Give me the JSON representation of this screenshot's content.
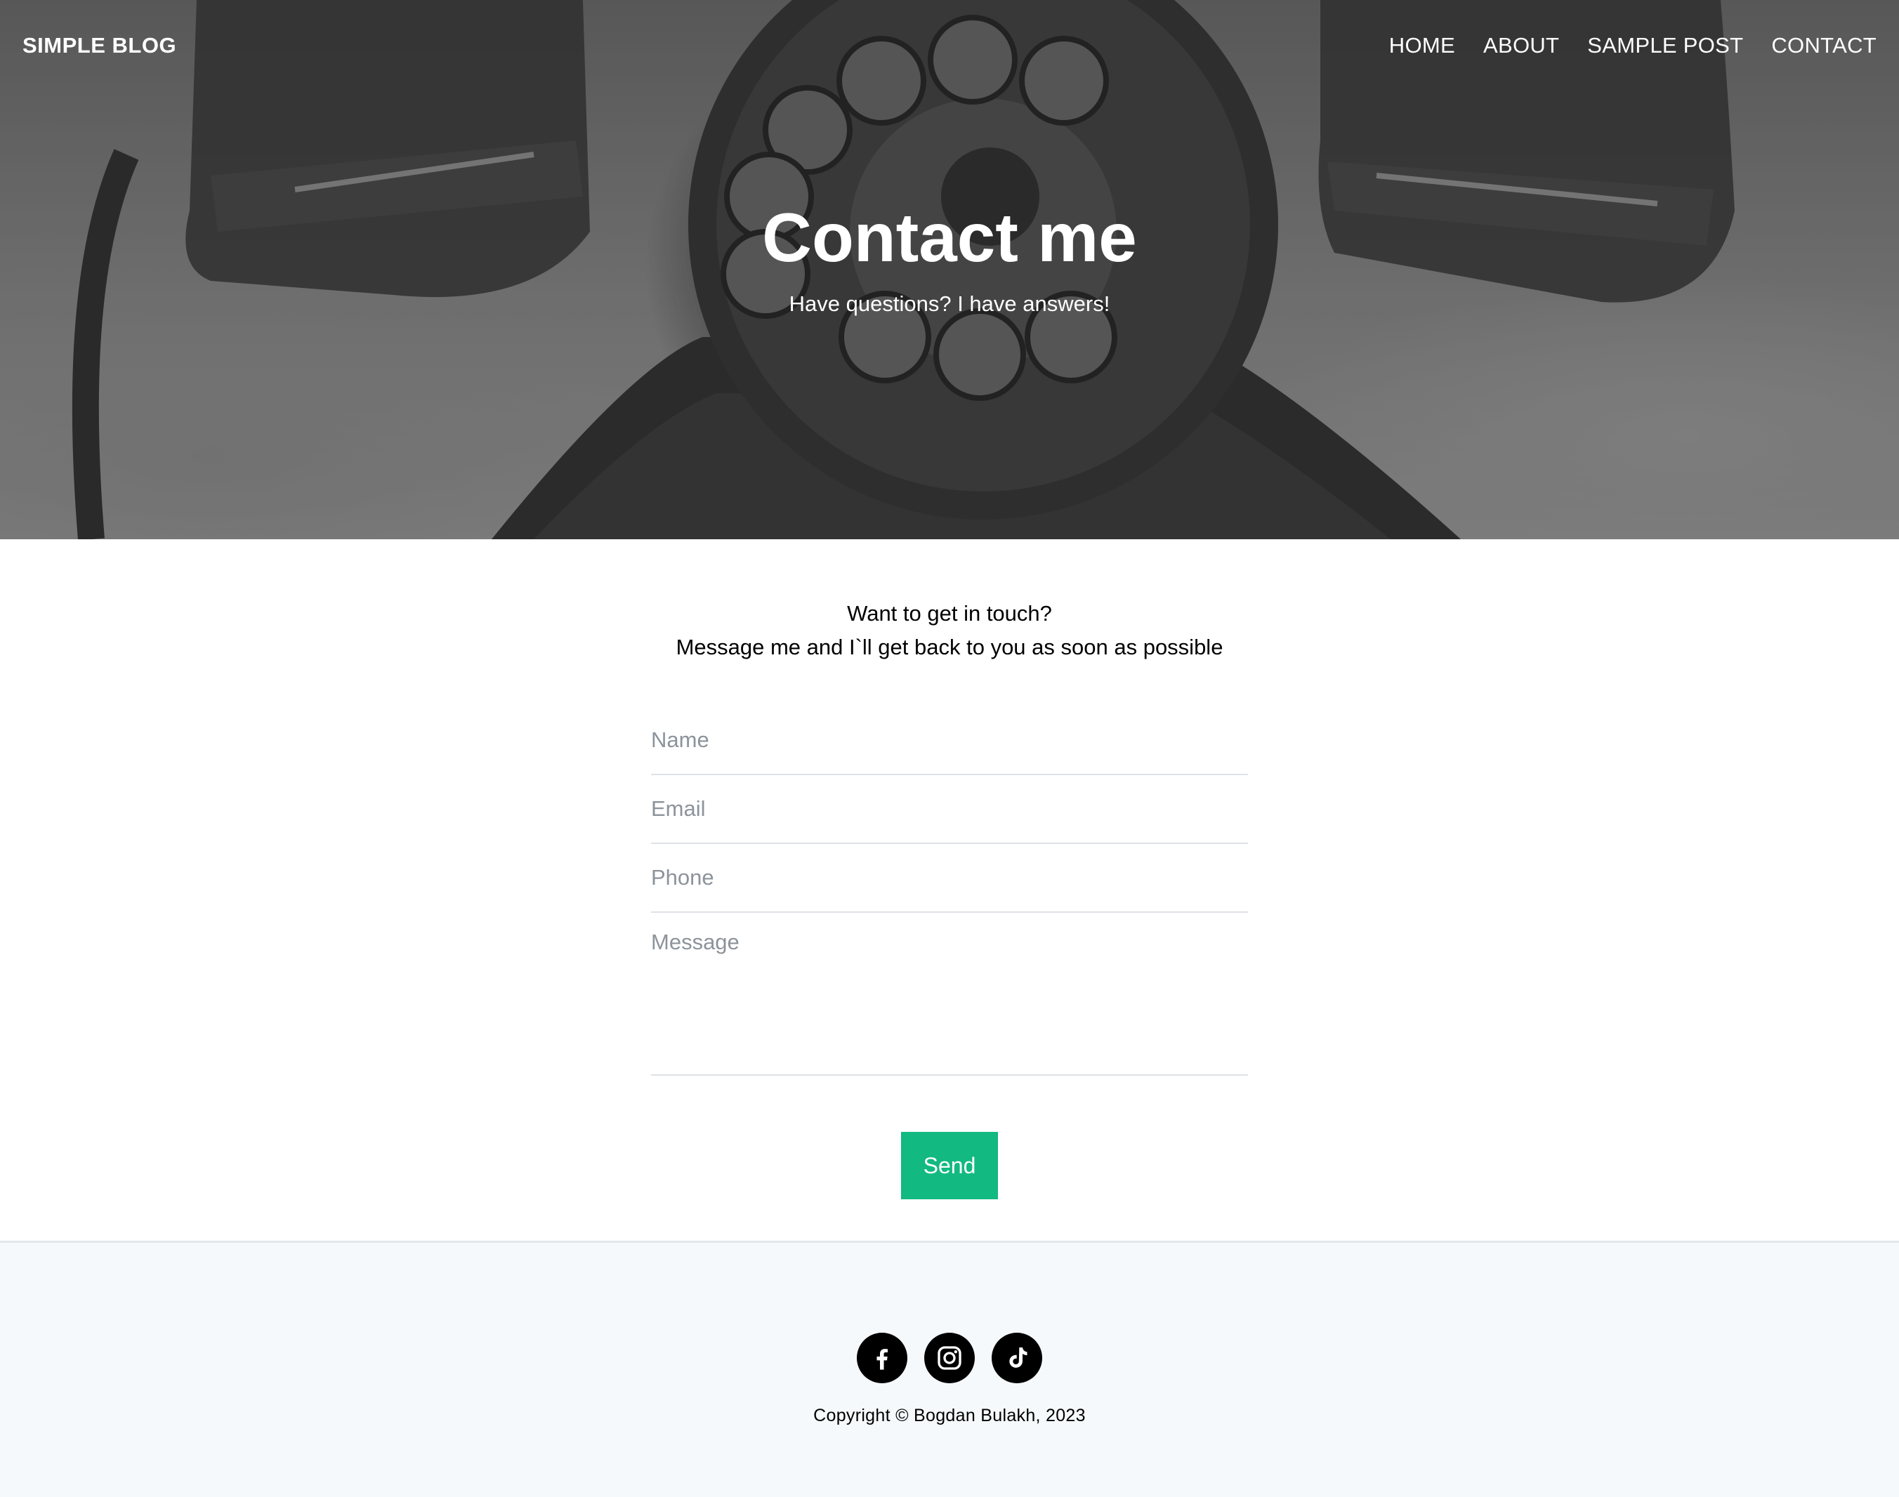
{
  "nav": {
    "brand": "SIMPLE BLOG",
    "links": [
      "HOME",
      "ABOUT",
      "SAMPLE POST",
      "CONTACT"
    ]
  },
  "hero": {
    "title": "Contact me",
    "subtitle": "Have questions? I have answers!"
  },
  "intro": {
    "line1": "Want to get in touch?",
    "line2": "Message me and I`ll get back to you as soon as possible"
  },
  "form": {
    "name_placeholder": "Name",
    "email_placeholder": "Email",
    "phone_placeholder": "Phone",
    "message_placeholder": "Message",
    "send_label": "Send",
    "send_color": "#12b981"
  },
  "footer": {
    "social_icons": [
      "facebook-icon",
      "instagram-icon",
      "tiktok-icon"
    ],
    "copyright": "Copyright © Bogdan Bulakh, 2023"
  }
}
